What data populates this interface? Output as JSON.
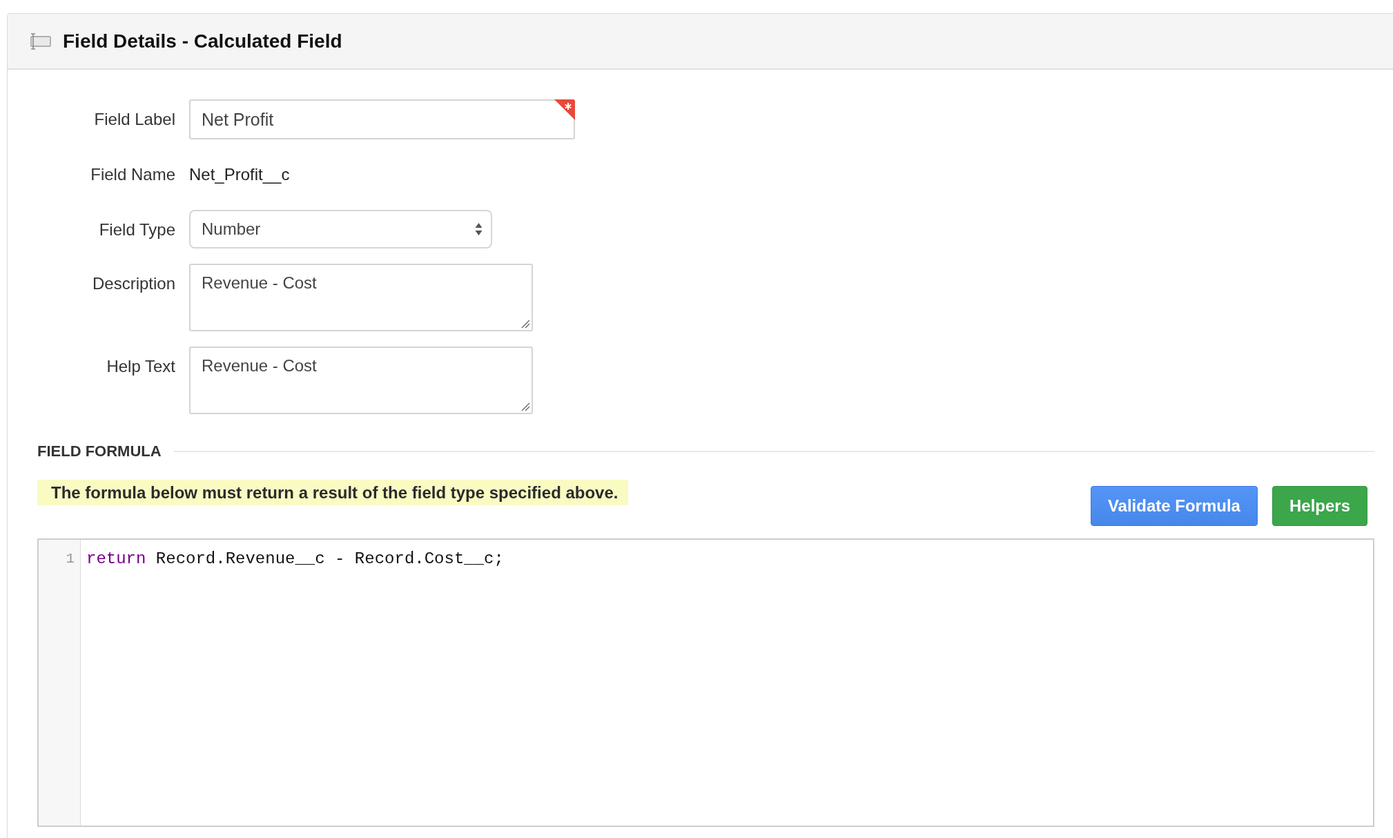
{
  "panel": {
    "title": "Field Details - Calculated Field"
  },
  "fields": [
    {
      "kind": "input",
      "label": "Field Label",
      "value": "Net Profit",
      "required": true
    },
    {
      "kind": "static",
      "label": "Field Name",
      "value": "Net_Profit__c",
      "required": false
    },
    {
      "kind": "select",
      "label": "Field Type",
      "value": "Number",
      "required": false
    },
    {
      "kind": "textarea",
      "label": "Description",
      "value": "Revenue - Cost",
      "required": false
    },
    {
      "kind": "textarea",
      "label": "Help Text",
      "value": "Revenue - Cost",
      "required": false
    }
  ],
  "formula_section": {
    "heading": "FIELD FORMULA",
    "note": "The formula below must return a result of the field type specified above.",
    "buttons": [
      {
        "kind": "primary",
        "label": "Validate Formula"
      },
      {
        "kind": "success",
        "label": "Helpers"
      }
    ]
  },
  "editor": {
    "lines": [
      {
        "number": "1",
        "tokens": [
          {
            "kind": "keyword",
            "text": "return"
          },
          {
            "kind": "plain",
            "text": " Record.Revenue__c - Record.Cost__c;"
          }
        ]
      }
    ]
  }
}
